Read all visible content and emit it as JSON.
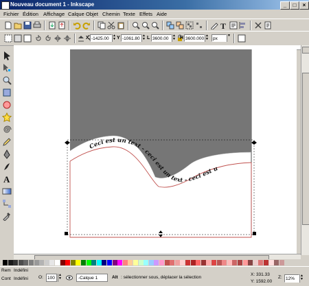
{
  "window": {
    "title": "Nouveau document 1 - Inkscape"
  },
  "menu": [
    "Fichier",
    "Édition",
    "Affichage",
    "Calque",
    "Objet",
    "Chemin",
    "Texte",
    "Effets",
    "Aide"
  ],
  "toolbar": {
    "x_label": "X",
    "x_value": "-1425.00",
    "y_label": "Y",
    "y_value": "-1061.80",
    "w_label": "L",
    "w_value": "3600.00",
    "h_label": "H",
    "h_value": "3600.000",
    "unit": "px"
  },
  "canvas": {
    "path_text": "Ceci est un text - ceci est un text - ceci est un text"
  },
  "status": {
    "fill_label": "Rem",
    "fill_value": "Indéfini",
    "stroke_label": "Cont",
    "stroke_value": "Indéfini",
    "opacity_label": "O:",
    "opacity_value": "100",
    "layer": "-Calque 1",
    "hint_bold": "Alt",
    "hint_text": " : sélectionner sous, déplacer la sélection",
    "x_readout": "X: 331.33",
    "y_readout": "Y: 1592.00",
    "zoom_label": "Z:",
    "zoom_value": "12%"
  },
  "colors": {
    "title_gradient_start": "#0a246a",
    "title_gradient_end": "#a6caf0",
    "chrome": "#d4d0c8",
    "shape_fill": "#767676",
    "path_stroke": "#c0504d"
  },
  "palette": [
    "#000000",
    "#1a1a1a",
    "#333333",
    "#4d4d4d",
    "#666666",
    "#808080",
    "#999999",
    "#b3b3b3",
    "#cccccc",
    "#e6e6e6",
    "#ffffff",
    "#800000",
    "#ff0000",
    "#808000",
    "#ffff00",
    "#008000",
    "#00ff00",
    "#008080",
    "#00ffff",
    "#000080",
    "#0000ff",
    "#800080",
    "#ff00ff",
    "#ff8080",
    "#ffcc99",
    "#ffff99",
    "#ccffcc",
    "#99ffff",
    "#99ccff",
    "#cc99ff",
    "#ff99cc",
    "#c0504d",
    "#e07070",
    "#f0a0a0",
    "#ffd0d0",
    "#cc3333",
    "#aa2222",
    "#ff6666",
    "#993333",
    "#ffaaaa",
    "#dd4444",
    "#bb5555",
    "#ee8888",
    "#ffbbbb",
    "#cc6666",
    "#aa4444",
    "#ff9999",
    "#884444",
    "#eecccc",
    "#dd7777",
    "#bb3333",
    "#ffdddd",
    "#996666",
    "#cc9999"
  ]
}
